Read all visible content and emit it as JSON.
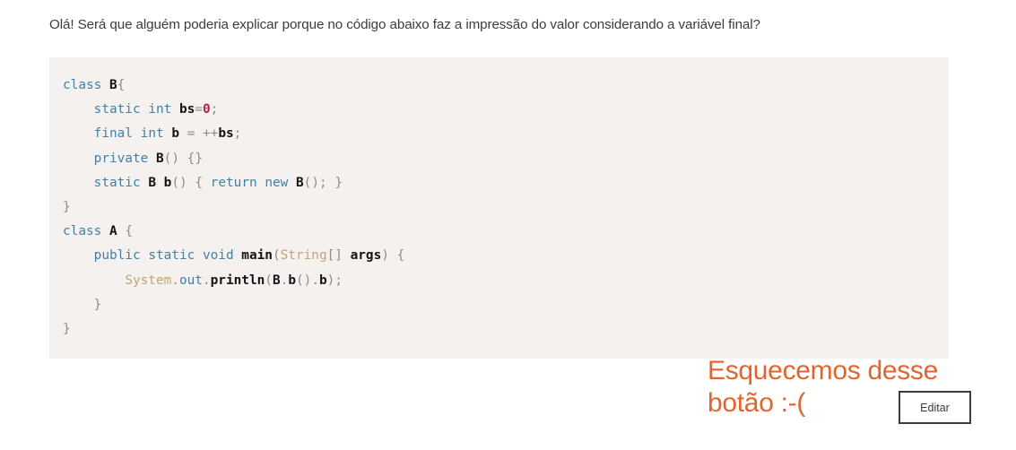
{
  "question": {
    "text": "Olá! Será que alguém poderia explicar porque no código abaixo faz a impressão do valor considerando a variável final?"
  },
  "code": {
    "language": "java",
    "lines": [
      [
        {
          "t": "class",
          "c": "kw"
        },
        {
          "t": " ",
          "c": "plain"
        },
        {
          "t": "B",
          "c": "id"
        },
        {
          "t": "{",
          "c": "punc"
        }
      ],
      [
        {
          "t": "    ",
          "c": "plain"
        },
        {
          "t": "static",
          "c": "kw"
        },
        {
          "t": " ",
          "c": "plain"
        },
        {
          "t": "int",
          "c": "kw"
        },
        {
          "t": " ",
          "c": "plain"
        },
        {
          "t": "bs",
          "c": "id"
        },
        {
          "t": "=",
          "c": "punc"
        },
        {
          "t": "0",
          "c": "num"
        },
        {
          "t": ";",
          "c": "punc"
        }
      ],
      [
        {
          "t": "    ",
          "c": "plain"
        },
        {
          "t": "final",
          "c": "kw"
        },
        {
          "t": " ",
          "c": "plain"
        },
        {
          "t": "int",
          "c": "kw"
        },
        {
          "t": " ",
          "c": "plain"
        },
        {
          "t": "b",
          "c": "id"
        },
        {
          "t": " ",
          "c": "plain"
        },
        {
          "t": "=",
          "c": "punc"
        },
        {
          "t": " ",
          "c": "plain"
        },
        {
          "t": "++",
          "c": "punc"
        },
        {
          "t": "bs",
          "c": "id"
        },
        {
          "t": ";",
          "c": "punc"
        }
      ],
      [
        {
          "t": "    ",
          "c": "plain"
        },
        {
          "t": "private",
          "c": "kw"
        },
        {
          "t": " ",
          "c": "plain"
        },
        {
          "t": "B",
          "c": "id"
        },
        {
          "t": "()",
          "c": "punc"
        },
        {
          "t": " ",
          "c": "plain"
        },
        {
          "t": "{}",
          "c": "punc"
        }
      ],
      [
        {
          "t": "    ",
          "c": "plain"
        },
        {
          "t": "static",
          "c": "kw"
        },
        {
          "t": " ",
          "c": "plain"
        },
        {
          "t": "B",
          "c": "id"
        },
        {
          "t": " ",
          "c": "plain"
        },
        {
          "t": "b",
          "c": "id"
        },
        {
          "t": "()",
          "c": "punc"
        },
        {
          "t": " ",
          "c": "plain"
        },
        {
          "t": "{",
          "c": "punc"
        },
        {
          "t": " ",
          "c": "plain"
        },
        {
          "t": "return",
          "c": "kw"
        },
        {
          "t": " ",
          "c": "plain"
        },
        {
          "t": "new",
          "c": "kw"
        },
        {
          "t": " ",
          "c": "plain"
        },
        {
          "t": "B",
          "c": "id"
        },
        {
          "t": "();",
          "c": "punc"
        },
        {
          "t": " ",
          "c": "plain"
        },
        {
          "t": "}",
          "c": "punc"
        }
      ],
      [
        {
          "t": "}",
          "c": "punc"
        }
      ],
      [
        {
          "t": "class",
          "c": "kw"
        },
        {
          "t": " ",
          "c": "plain"
        },
        {
          "t": "A",
          "c": "id"
        },
        {
          "t": " ",
          "c": "plain"
        },
        {
          "t": "{",
          "c": "punc"
        }
      ],
      [
        {
          "t": "    ",
          "c": "plain"
        },
        {
          "t": "public",
          "c": "kw"
        },
        {
          "t": " ",
          "c": "plain"
        },
        {
          "t": "static",
          "c": "kw"
        },
        {
          "t": " ",
          "c": "plain"
        },
        {
          "t": "void",
          "c": "kw"
        },
        {
          "t": " ",
          "c": "plain"
        },
        {
          "t": "main",
          "c": "id"
        },
        {
          "t": "(",
          "c": "punc"
        },
        {
          "t": "String",
          "c": "type"
        },
        {
          "t": "[]",
          "c": "punc"
        },
        {
          "t": " ",
          "c": "plain"
        },
        {
          "t": "args",
          "c": "id"
        },
        {
          "t": ")",
          "c": "punc"
        },
        {
          "t": " ",
          "c": "plain"
        },
        {
          "t": "{",
          "c": "punc"
        }
      ],
      [
        {
          "t": "        ",
          "c": "plain"
        },
        {
          "t": "System",
          "c": "type"
        },
        {
          "t": ".",
          "c": "punc"
        },
        {
          "t": "out",
          "c": "kw"
        },
        {
          "t": ".",
          "c": "punc"
        },
        {
          "t": "println",
          "c": "id"
        },
        {
          "t": "(",
          "c": "punc"
        },
        {
          "t": "B",
          "c": "id"
        },
        {
          "t": ".",
          "c": "punc"
        },
        {
          "t": "b",
          "c": "id"
        },
        {
          "t": "()",
          "c": "punc"
        },
        {
          "t": ".",
          "c": "punc"
        },
        {
          "t": "b",
          "c": "id"
        },
        {
          "t": ");",
          "c": "punc"
        }
      ],
      [
        {
          "t": "    ",
          "c": "plain"
        },
        {
          "t": "}",
          "c": "punc"
        }
      ],
      [
        {
          "t": "}",
          "c": "punc"
        }
      ]
    ]
  },
  "annotation": {
    "line1": "Esquecemos desse",
    "line2": "botão :-(",
    "color": "#e0652f"
  },
  "edit_button": {
    "label": "Editar"
  },
  "colors": {
    "code_background": "#f4f1ef",
    "keyword": "#4281a4",
    "identifier": "#141414",
    "number": "#b0214d",
    "type": "#c3a475",
    "punctuation": "#8d8d8d",
    "text": "#3c3c3c",
    "annotation_orange": "#e0652f"
  }
}
